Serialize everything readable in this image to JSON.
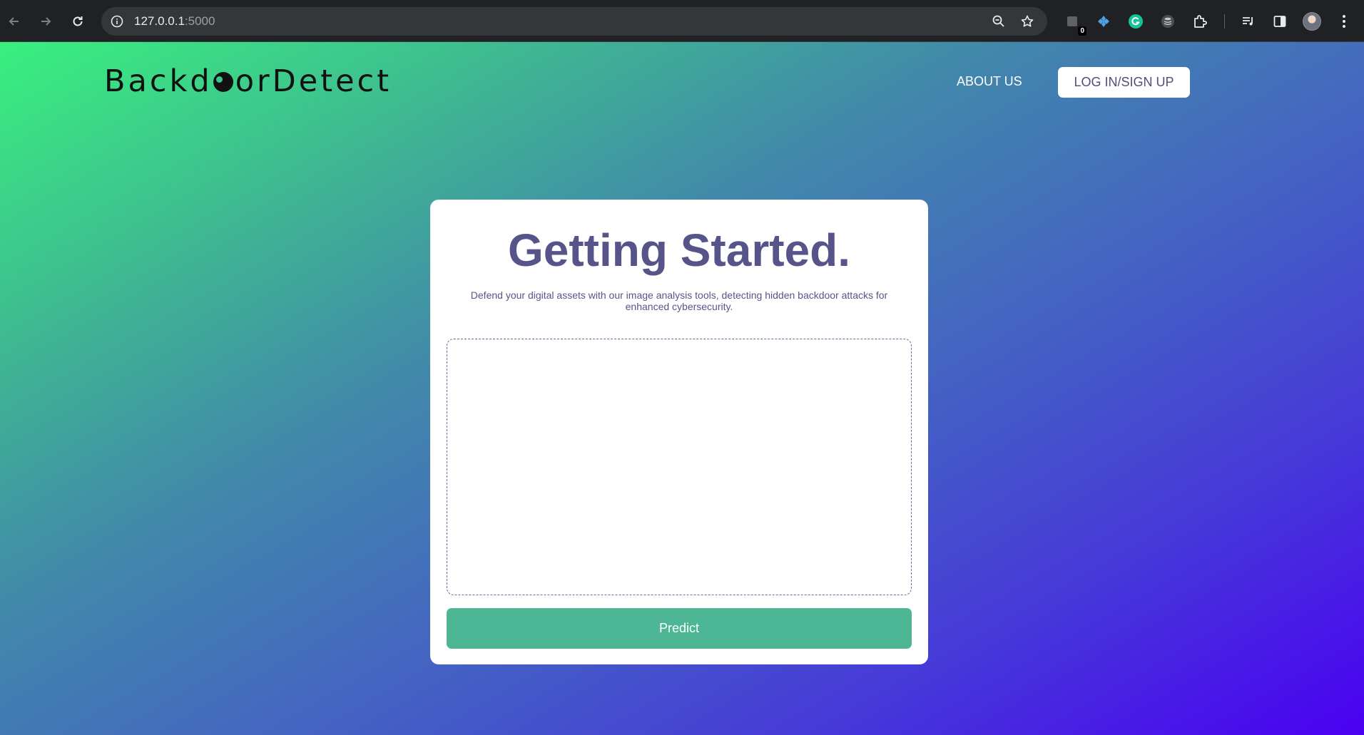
{
  "browser": {
    "url_host": "127.0.0.1",
    "url_port": ":5000",
    "extension_badge": "0",
    "icons": {
      "back": "arrow-left-icon",
      "forward": "arrow-right-icon",
      "reload": "reload-icon",
      "site_info": "info-icon",
      "zoom": "zoom-out-icon",
      "bookmark": "star-icon",
      "extensions": "puzzle-icon",
      "menu": "kebab-menu-icon"
    }
  },
  "header": {
    "logo_before": "Backd",
    "logo_after": "orDetect",
    "about_label": "ABOUT US",
    "login_label": "LOG IN/SIGN UP"
  },
  "card": {
    "title": "Getting Started.",
    "subtitle": "Defend your digital assets with our image analysis tools, detecting hidden backdoor attacks for enhanced cybersecurity.",
    "predict_label": "Predict"
  },
  "colors": {
    "gradient_start": "#39f07e",
    "gradient_end": "#4a00f2",
    "title_color": "#57548a",
    "predict_button": "#4cb695"
  }
}
